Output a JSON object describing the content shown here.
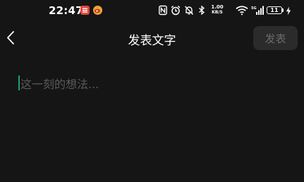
{
  "status_bar": {
    "time": "22:47",
    "network_speed_value": "1.00",
    "network_speed_unit": "KB/S",
    "battery_level": "11",
    "icons": [
      "app-notification-icon",
      "weibo-icon",
      "nfc-icon",
      "alarm-icon",
      "mute-icon",
      "bluetooth-icon",
      "wifi-icon",
      "signal-icon",
      "charging-icon"
    ]
  },
  "header": {
    "title": "发表文字",
    "publish_label": "发表",
    "back_icon": "chevron-left-icon"
  },
  "editor": {
    "placeholder": "这一刻的想法...",
    "value": ""
  },
  "colors": {
    "background": "#151515",
    "caret": "#1fa16b",
    "placeholder": "#5a5a5a",
    "publish_disabled_bg": "#2b2b2b",
    "publish_disabled_text": "#6a6a6a"
  }
}
